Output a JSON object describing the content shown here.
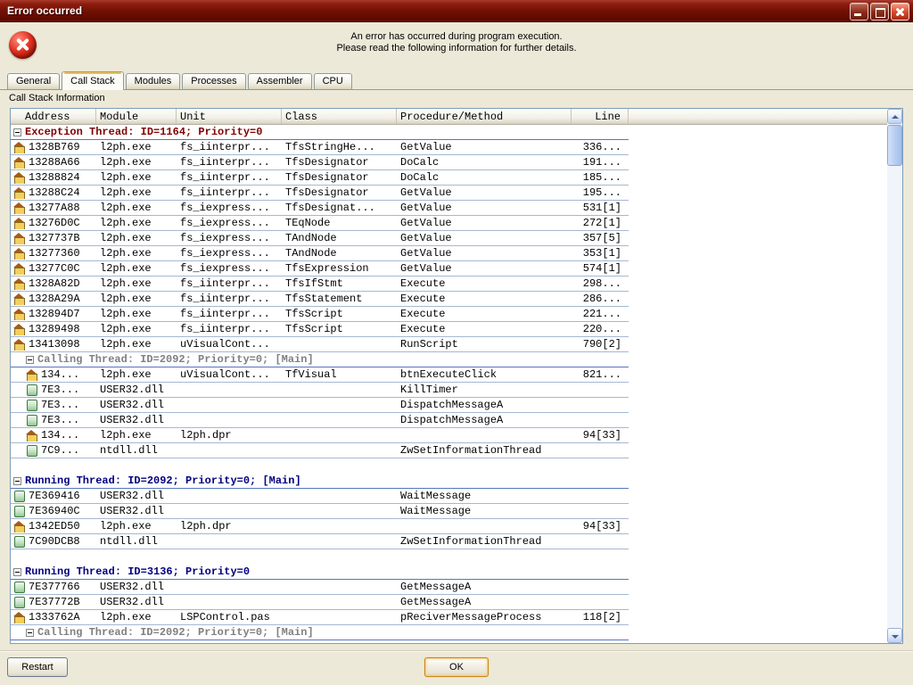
{
  "window": {
    "title": "Error occurred",
    "message_line1": "An error has occurred during program execution.",
    "message_line2": "Please read the following information for further details."
  },
  "tabs": [
    {
      "label": "General",
      "active": false
    },
    {
      "label": "Call Stack",
      "active": true
    },
    {
      "label": "Modules",
      "active": false
    },
    {
      "label": "Processes",
      "active": false
    },
    {
      "label": "Assembler",
      "active": false
    },
    {
      "label": "CPU",
      "active": false
    }
  ],
  "call_stack": {
    "section_label": "Call Stack Information",
    "columns": [
      "Address",
      "Module",
      "Unit",
      "Class",
      "Procedure/Method",
      "Line"
    ],
    "rows": [
      {
        "type": "thread",
        "style": "exception",
        "indent": 0,
        "text": "Exception Thread: ID=1164; Priority=0"
      },
      {
        "type": "entry",
        "icon": "exe",
        "indent": 0,
        "address": "1328B769",
        "module": "l2ph.exe",
        "unit": "fs_iinterpr...",
        "class": "TfsStringHe...",
        "proc": "GetValue",
        "line": "336..."
      },
      {
        "type": "entry",
        "icon": "exe",
        "indent": 0,
        "address": "13288A66",
        "module": "l2ph.exe",
        "unit": "fs_iinterpr...",
        "class": "TfsDesignator",
        "proc": "DoCalc",
        "line": "191..."
      },
      {
        "type": "entry",
        "icon": "exe",
        "indent": 0,
        "address": "13288824",
        "module": "l2ph.exe",
        "unit": "fs_iinterpr...",
        "class": "TfsDesignator",
        "proc": "DoCalc",
        "line": "185..."
      },
      {
        "type": "entry",
        "icon": "exe",
        "indent": 0,
        "address": "13288C24",
        "module": "l2ph.exe",
        "unit": "fs_iinterpr...",
        "class": "TfsDesignator",
        "proc": "GetValue",
        "line": "195..."
      },
      {
        "type": "entry",
        "icon": "exe",
        "indent": 0,
        "address": "13277A88",
        "module": "l2ph.exe",
        "unit": "fs_iexpress...",
        "class": "TfsDesignat...",
        "proc": "GetValue",
        "line": "531[1]"
      },
      {
        "type": "entry",
        "icon": "exe",
        "indent": 0,
        "address": "13276D0C",
        "module": "l2ph.exe",
        "unit": "fs_iexpress...",
        "class": "TEqNode",
        "proc": "GetValue",
        "line": "272[1]"
      },
      {
        "type": "entry",
        "icon": "exe",
        "indent": 0,
        "address": "1327737B",
        "module": "l2ph.exe",
        "unit": "fs_iexpress...",
        "class": "TAndNode",
        "proc": "GetValue",
        "line": "357[5]"
      },
      {
        "type": "entry",
        "icon": "exe",
        "indent": 0,
        "address": "13277360",
        "module": "l2ph.exe",
        "unit": "fs_iexpress...",
        "class": "TAndNode",
        "proc": "GetValue",
        "line": "353[1]"
      },
      {
        "type": "entry",
        "icon": "exe",
        "indent": 0,
        "address": "13277C0C",
        "module": "l2ph.exe",
        "unit": "fs_iexpress...",
        "class": "TfsExpression",
        "proc": "GetValue",
        "line": "574[1]"
      },
      {
        "type": "entry",
        "icon": "exe",
        "indent": 0,
        "address": "1328A82D",
        "module": "l2ph.exe",
        "unit": "fs_iinterpr...",
        "class": "TfsIfStmt",
        "proc": "Execute",
        "line": "298..."
      },
      {
        "type": "entry",
        "icon": "exe",
        "indent": 0,
        "address": "1328A29A",
        "module": "l2ph.exe",
        "unit": "fs_iinterpr...",
        "class": "TfsStatement",
        "proc": "Execute",
        "line": "286..."
      },
      {
        "type": "entry",
        "icon": "exe",
        "indent": 0,
        "address": "132894D7",
        "module": "l2ph.exe",
        "unit": "fs_iinterpr...",
        "class": "TfsScript",
        "proc": "Execute",
        "line": "221..."
      },
      {
        "type": "entry",
        "icon": "exe",
        "indent": 0,
        "address": "13289498",
        "module": "l2ph.exe",
        "unit": "fs_iinterpr...",
        "class": "TfsScript",
        "proc": "Execute",
        "line": "220..."
      },
      {
        "type": "entry",
        "icon": "exe",
        "indent": 0,
        "address": "13413098",
        "module": "l2ph.exe",
        "unit": "uVisualCont...",
        "class": "",
        "proc": "RunScript",
        "line": "790[2]"
      },
      {
        "type": "thread",
        "style": "calling",
        "indent": 1,
        "text": "Calling Thread: ID=2092; Priority=0; [Main]"
      },
      {
        "type": "entry",
        "icon": "exe",
        "indent": 1,
        "address": "134...",
        "module": "l2ph.exe",
        "unit": "uVisualCont...",
        "class": "TfVisual",
        "proc": "btnExecuteClick",
        "line": "821..."
      },
      {
        "type": "entry",
        "icon": "dll",
        "indent": 1,
        "address": "7E3...",
        "module": "USER32.dll",
        "unit": "",
        "class": "",
        "proc": "KillTimer",
        "line": ""
      },
      {
        "type": "entry",
        "icon": "dll",
        "indent": 1,
        "address": "7E3...",
        "module": "USER32.dll",
        "unit": "",
        "class": "",
        "proc": "DispatchMessageA",
        "line": ""
      },
      {
        "type": "entry",
        "icon": "dll",
        "indent": 1,
        "address": "7E3...",
        "module": "USER32.dll",
        "unit": "",
        "class": "",
        "proc": "DispatchMessageA",
        "line": ""
      },
      {
        "type": "entry",
        "icon": "exe",
        "indent": 1,
        "address": "134...",
        "module": "l2ph.exe",
        "unit": "l2ph.dpr",
        "class": "",
        "proc": "",
        "line": "94[33]"
      },
      {
        "type": "entry",
        "icon": "dll",
        "indent": 1,
        "address": "7C9...",
        "module": "ntdll.dll",
        "unit": "",
        "class": "",
        "proc": "ZwSetInformationThread",
        "line": ""
      },
      {
        "type": "spacer"
      },
      {
        "type": "thread",
        "style": "running",
        "indent": 0,
        "text": "Running Thread: ID=2092; Priority=0; [Main]"
      },
      {
        "type": "entry",
        "icon": "dll",
        "indent": 0,
        "address": "7E369416",
        "module": "USER32.dll",
        "unit": "",
        "class": "",
        "proc": "WaitMessage",
        "line": ""
      },
      {
        "type": "entry",
        "icon": "dll",
        "indent": 0,
        "address": "7E36940C",
        "module": "USER32.dll",
        "unit": "",
        "class": "",
        "proc": "WaitMessage",
        "line": ""
      },
      {
        "type": "entry",
        "icon": "exe",
        "indent": 0,
        "address": "1342ED50",
        "module": "l2ph.exe",
        "unit": "l2ph.dpr",
        "class": "",
        "proc": "",
        "line": "94[33]"
      },
      {
        "type": "entry",
        "icon": "dll",
        "indent": 0,
        "address": "7C90DCB8",
        "module": "ntdll.dll",
        "unit": "",
        "class": "",
        "proc": "ZwSetInformationThread",
        "line": ""
      },
      {
        "type": "spacer"
      },
      {
        "type": "thread",
        "style": "running",
        "indent": 0,
        "text": "Running Thread: ID=3136; Priority=0"
      },
      {
        "type": "entry",
        "icon": "dll",
        "indent": 0,
        "address": "7E377766",
        "module": "USER32.dll",
        "unit": "",
        "class": "",
        "proc": "GetMessageA",
        "line": ""
      },
      {
        "type": "entry",
        "icon": "dll",
        "indent": 0,
        "address": "7E37772B",
        "module": "USER32.dll",
        "unit": "",
        "class": "",
        "proc": "GetMessageA",
        "line": ""
      },
      {
        "type": "entry",
        "icon": "exe",
        "indent": 0,
        "address": "1333762A",
        "module": "l2ph.exe",
        "unit": "LSPControl.pas",
        "class": "",
        "proc": "pReciverMessageProcess",
        "line": "118[2]"
      },
      {
        "type": "thread",
        "style": "calling",
        "indent": 1,
        "text": "Calling Thread: ID=2092; Priority=0; [Main]"
      }
    ]
  },
  "buttons": {
    "restart": "Restart",
    "ok": "OK"
  },
  "colors": {
    "titlebar": "#701004",
    "window_background": "#ece9d8",
    "exception_thread_text": "#800000",
    "calling_thread_text": "#808080",
    "running_thread_text": "#000080",
    "thread_underline": "#5577bb",
    "row_underline": "#a6b8d0",
    "ok_focus_ring": "#c9891a"
  }
}
